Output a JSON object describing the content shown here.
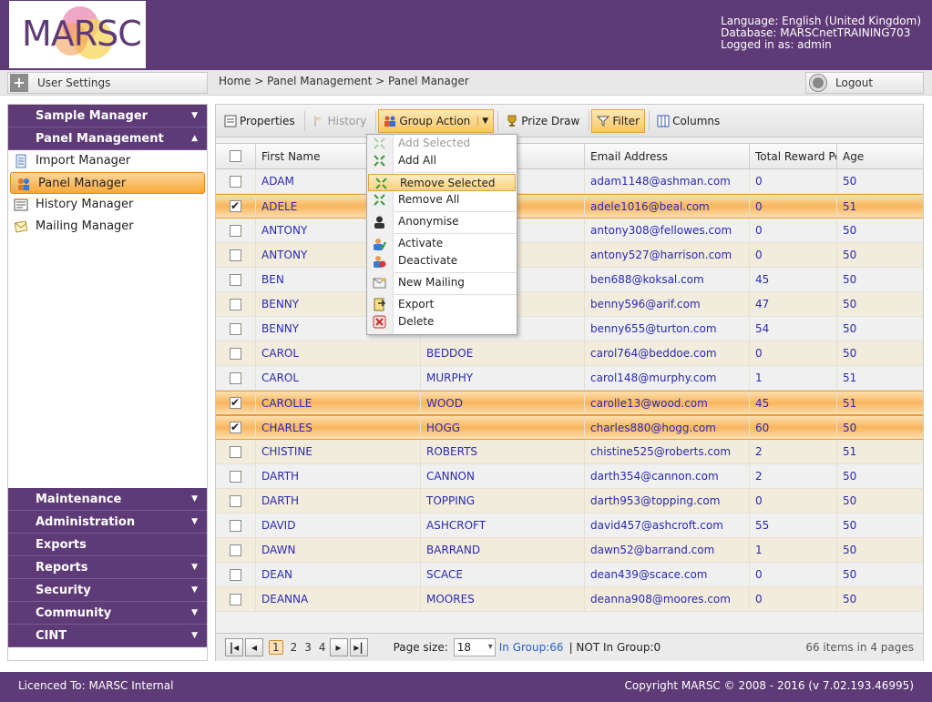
{
  "header": {
    "logo_text": "MARSC",
    "language": "Language: English (United Kingdom)",
    "database": "Database: MARSCnetTRAINING703",
    "logged_in": "Logged in as: admin"
  },
  "topbar": {
    "user_settings": "User Settings",
    "breadcrumb": "Home > Panel Management > Panel Manager",
    "logout": "Logout"
  },
  "sidebar": {
    "sample_manager": "Sample Manager",
    "panel_management": "Panel Management",
    "items": [
      {
        "label": "Import Manager",
        "icon": "import-icon"
      },
      {
        "label": "Panel Manager",
        "icon": "panel-icon"
      },
      {
        "label": "History Manager",
        "icon": "history-icon"
      },
      {
        "label": "Mailing Manager",
        "icon": "mailing-icon"
      }
    ],
    "sections": [
      "Maintenance",
      "Administration",
      "Exports",
      "Reports",
      "Security",
      "Community",
      "CINT"
    ]
  },
  "toolbar": {
    "properties": "Properties",
    "history": "History",
    "group_action": "Group Action",
    "prize_draw": "Prize Draw",
    "filter": "Filter",
    "columns": "Columns"
  },
  "menu": {
    "add_selected": "Add Selected",
    "add_all": "Add All",
    "remove_selected": "Remove Selected",
    "remove_all": "Remove All",
    "anonymise": "Anonymise",
    "activate": "Activate",
    "deactivate": "Deactivate",
    "new_mailing": "New Mailing",
    "export": "Export",
    "delete": "Delete"
  },
  "grid": {
    "columns": [
      "First Name",
      "",
      "Email Address",
      "Total Reward Po",
      "Age"
    ],
    "rows": [
      {
        "first": "ADAM",
        "last": "",
        "email": "adam1148@ashman.com",
        "reward": "0",
        "age": "50",
        "checked": false
      },
      {
        "first": "ADELE",
        "last": "",
        "email": "adele1016@beal.com",
        "reward": "0",
        "age": "51",
        "checked": true
      },
      {
        "first": "ANTONY",
        "last": "",
        "email": "antony308@fellowes.com",
        "reward": "0",
        "age": "50",
        "checked": false
      },
      {
        "first": "ANTONY",
        "last": "",
        "email": "antony527@harrison.com",
        "reward": "0",
        "age": "50",
        "checked": false
      },
      {
        "first": "BEN",
        "last": "",
        "email": "ben688@koksal.com",
        "reward": "45",
        "age": "50",
        "checked": false
      },
      {
        "first": "BENNY",
        "last": "",
        "email": "benny596@arif.com",
        "reward": "47",
        "age": "50",
        "checked": false
      },
      {
        "first": "BENNY",
        "last": "",
        "email": "benny655@turton.com",
        "reward": "54",
        "age": "50",
        "checked": false
      },
      {
        "first": "CAROL",
        "last": "BEDDOE",
        "email": "carol764@beddoe.com",
        "reward": "0",
        "age": "50",
        "checked": false
      },
      {
        "first": "CAROL",
        "last": "MURPHY",
        "email": "carol148@murphy.com",
        "reward": "1",
        "age": "51",
        "checked": false
      },
      {
        "first": "CAROLLE",
        "last": "WOOD",
        "email": "carolle13@wood.com",
        "reward": "45",
        "age": "51",
        "checked": true
      },
      {
        "first": "CHARLES",
        "last": "HOGG",
        "email": "charles880@hogg.com",
        "reward": "60",
        "age": "50",
        "checked": true
      },
      {
        "first": "CHISTINE",
        "last": "ROBERTS",
        "email": "chistine525@roberts.com",
        "reward": "2",
        "age": "51",
        "checked": false
      },
      {
        "first": "DARTH",
        "last": "CANNON",
        "email": "darth354@cannon.com",
        "reward": "2",
        "age": "50",
        "checked": false
      },
      {
        "first": "DARTH",
        "last": "TOPPING",
        "email": "darth953@topping.com",
        "reward": "0",
        "age": "50",
        "checked": false
      },
      {
        "first": "DAVID",
        "last": "ASHCROFT",
        "email": "david457@ashcroft.com",
        "reward": "55",
        "age": "50",
        "checked": false
      },
      {
        "first": "DAWN",
        "last": "BARRAND",
        "email": "dawn52@barrand.com",
        "reward": "1",
        "age": "50",
        "checked": false
      },
      {
        "first": "DEAN",
        "last": "SCACE",
        "email": "dean439@scace.com",
        "reward": "0",
        "age": "50",
        "checked": false
      },
      {
        "first": "DEANNA",
        "last": "MOORES",
        "email": "deanna908@moores.com",
        "reward": "0",
        "age": "50",
        "checked": false
      }
    ]
  },
  "pager": {
    "pages": [
      "1",
      "2",
      "3",
      "4"
    ],
    "current": "1",
    "page_size_label": "Page size:",
    "page_size": "18",
    "in_group": "In Group:66",
    "not_in_group": "NOT In Group:0",
    "info": "66 items in 4 pages"
  },
  "footer": {
    "licence": "Licenced To: MARSC Internal",
    "copyright": "Copyright MARSC © 2008 - 2016  (v 7.02.193.46995)"
  },
  "colors": {
    "brand": "#5e3a76",
    "selected_row": "#f9b55c",
    "link": "#2a2ab0"
  }
}
